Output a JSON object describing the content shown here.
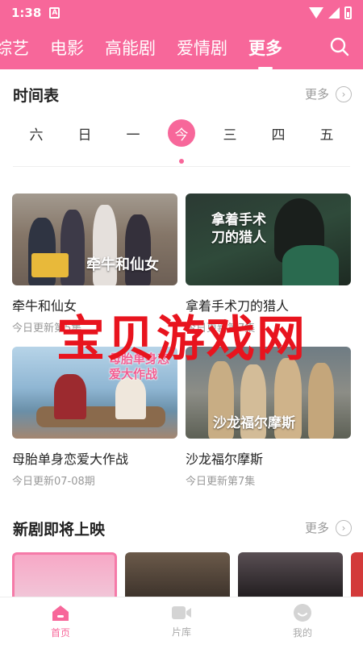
{
  "status_bar": {
    "time": "1:38",
    "sim_label": "A"
  },
  "tabs": [
    {
      "label": "综艺"
    },
    {
      "label": "电影"
    },
    {
      "label": "高能剧"
    },
    {
      "label": "爱情剧"
    },
    {
      "label": "更多",
      "active": true
    }
  ],
  "schedule": {
    "title": "时间表",
    "more_label": "更多",
    "days": [
      "六",
      "日",
      "一",
      "今",
      "三",
      "四",
      "五"
    ],
    "selected_day": "今"
  },
  "shows": [
    {
      "title": "牵牛和仙女",
      "subtitle": "今日更新第5集",
      "poster_text": "牵牛和仙女"
    },
    {
      "title": "拿着手术刀的猎人",
      "subtitle": "今日更新第7集",
      "poster_text": "拿着手术刀的猎人"
    },
    {
      "title": "母胎单身恋爱大作战",
      "subtitle": "今日更新07-08期",
      "poster_text": "母胎单身恋爱大作战"
    },
    {
      "title": "沙龙福尔摩斯",
      "subtitle": "今日更新第7集",
      "poster_text": "沙龙福尔摩斯"
    }
  ],
  "upcoming": {
    "title": "新剧即将上映",
    "more_label": "更多"
  },
  "watermark": "宝贝游戏网",
  "bottom_nav": [
    {
      "label": "首页",
      "icon": "home-icon",
      "active": true
    },
    {
      "label": "片库",
      "icon": "video-library-icon"
    },
    {
      "label": "我的",
      "icon": "profile-icon"
    }
  ],
  "colors": {
    "accent": "#f7679a",
    "watermark": "#e8141e"
  }
}
